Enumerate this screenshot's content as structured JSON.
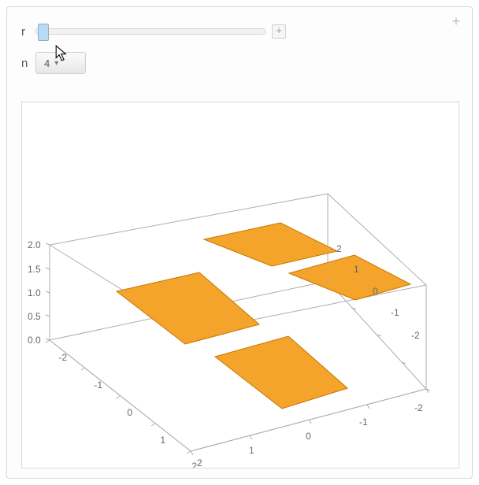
{
  "controls": {
    "r_label": "r",
    "slider_plus": "+",
    "n_label": "n",
    "n_value": "4",
    "panel_plus": "+"
  },
  "chart_data": {
    "type": "3d-surface",
    "x_range": [
      -2,
      2
    ],
    "y_range": [
      -2,
      2
    ],
    "z_range": [
      0,
      2
    ],
    "x_ticks": [
      -2,
      -1,
      0,
      1,
      2
    ],
    "y_ticks": [
      -2,
      -1,
      0,
      1,
      2
    ],
    "z_ticks": [
      0.0,
      0.5,
      1.0,
      1.5,
      2.0
    ],
    "z_tick_labels": [
      "0.0",
      "0.5",
      "1.0",
      "1.5",
      "2.0"
    ],
    "surfaces": [
      {
        "x": [
          -1.8,
          -0.2
        ],
        "y": [
          -1.8,
          -0.2
        ],
        "z": 0,
        "color": "#f29b1d"
      },
      {
        "x": [
          0.2,
          1.8
        ],
        "y": [
          -1.8,
          -0.2
        ],
        "z": 0,
        "color": "#f29b1d"
      },
      {
        "x": [
          -1.8,
          -0.2
        ],
        "y": [
          0.2,
          1.8
        ],
        "z": 0,
        "color": "#f29b1d"
      },
      {
        "x": [
          0.2,
          1.8
        ],
        "y": [
          0.2,
          1.8
        ],
        "z": 0,
        "color": "#f29b1d"
      }
    ],
    "title": "",
    "viewpoint": "oblique"
  }
}
